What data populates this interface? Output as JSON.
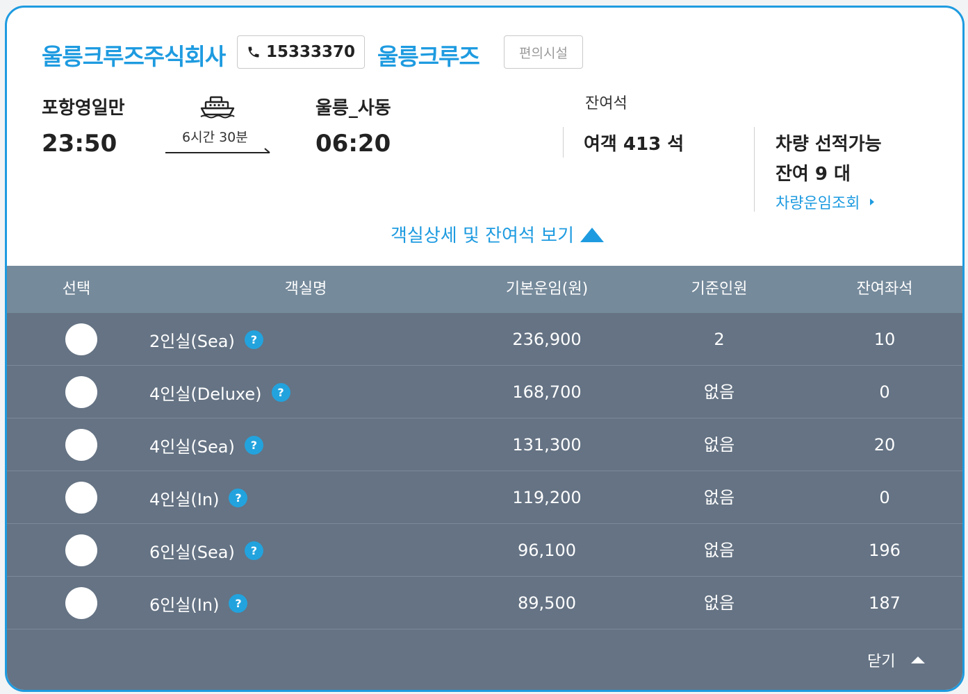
{
  "header": {
    "company": "울릉크루즈주식회사",
    "phone": "15333370",
    "brand": "울릉크루즈",
    "facility_label": "편의시설"
  },
  "route": {
    "departure_port": "포항영일만",
    "departure_time": "23:50",
    "duration": "6시간 30분",
    "arrival_port": "울릉_사동",
    "arrival_time": "06:20"
  },
  "seats": {
    "label": "잔여석",
    "passenger": "여객 413 석",
    "vehicle_line1": "차량 선적가능",
    "vehicle_line2": "잔여 9 대",
    "vehicle_link": "차량운임조회"
  },
  "toggle_label": "객실상세 및 잔여석 보기",
  "table": {
    "columns": [
      "선택",
      "객실명",
      "기본운임(원)",
      "기준인원",
      "잔여좌석"
    ],
    "rows": [
      {
        "name": "2인실(Sea)",
        "fare": "236,900",
        "base": "2",
        "remain": "10"
      },
      {
        "name": "4인실(Deluxe)",
        "fare": "168,700",
        "base": "없음",
        "remain": "0"
      },
      {
        "name": "4인실(Sea)",
        "fare": "131,300",
        "base": "없음",
        "remain": "20"
      },
      {
        "name": "4인실(In)",
        "fare": "119,200",
        "base": "없음",
        "remain": "0"
      },
      {
        "name": "6인실(Sea)",
        "fare": "96,100",
        "base": "없음",
        "remain": "196"
      },
      {
        "name": "6인실(In)",
        "fare": "89,500",
        "base": "없음",
        "remain": "187"
      }
    ],
    "help_symbol": "?"
  },
  "close_label": "닫기",
  "colors": {
    "accent": "#1e9be0",
    "table_header": "#758a9b",
    "table_body": "#657384",
    "help_badge": "#22a3de"
  },
  "icons": {
    "phone": "phone-icon",
    "ship": "ship-icon",
    "arrow": "arrow-right-icon",
    "caret_right": "caret-right-icon",
    "caret_up": "caret-up-icon",
    "help": "help-icon"
  }
}
